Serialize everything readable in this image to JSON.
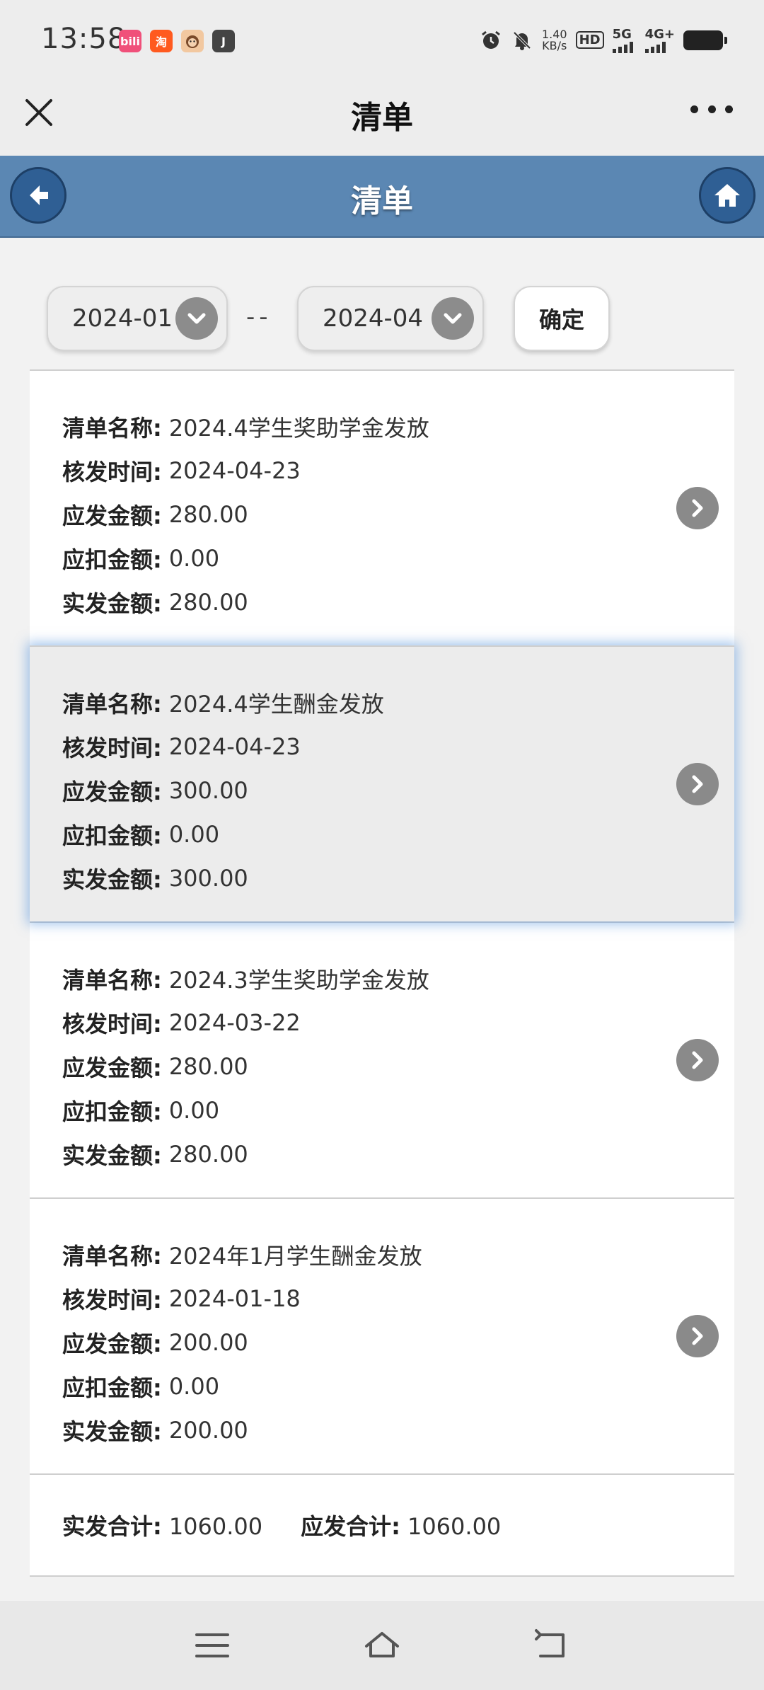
{
  "status_bar": {
    "time": "13:58",
    "apps": [
      {
        "icon": "bilibili-app-icon",
        "label": "bili",
        "color": "#f0507a"
      },
      {
        "icon": "taobao-app-icon",
        "label": "淘",
        "color": "#ff5a1f"
      },
      {
        "icon": "monkey-app-icon",
        "label": "",
        "color": "#f2c8a0"
      },
      {
        "icon": "j-app-icon",
        "label": "J",
        "color": "#444444"
      }
    ],
    "speed_value": "1.40",
    "speed_unit": "KB/s",
    "hd_label": "HD",
    "net_5g": "5G",
    "net_4g": "4G+"
  },
  "title_bar": {
    "title": "清单"
  },
  "header": {
    "title": "清单",
    "color": "#5b87b3"
  },
  "filter": {
    "start": "2024-01",
    "separator": "--",
    "end": "2024-04",
    "confirm_label": "确定"
  },
  "labels": {
    "name": "清单名称:",
    "date": "核发时间:",
    "payable": "应发金额:",
    "deduct": "应扣金额:",
    "actual": "实发金额:"
  },
  "items": [
    {
      "name": "2024.4学生奖助学金发放",
      "date": "2024-04-23",
      "payable": "280.00",
      "deduct": "0.00",
      "actual": "280.00"
    },
    {
      "name": "2024.4学生酬金发放",
      "date": "2024-04-23",
      "payable": "300.00",
      "deduct": "0.00",
      "actual": "300.00"
    },
    {
      "name": "2024.3学生奖助学金发放",
      "date": "2024-03-22",
      "payable": "280.00",
      "deduct": "0.00",
      "actual": "280.00"
    },
    {
      "name": "2024年1月学生酬金发放",
      "date": "2024-01-18",
      "payable": "200.00",
      "deduct": "0.00",
      "actual": "200.00"
    }
  ],
  "summary": {
    "actual_label": "实发合计:",
    "actual_total": "1060.00",
    "payable_label": "应发合计:",
    "payable_total": "1060.00"
  }
}
